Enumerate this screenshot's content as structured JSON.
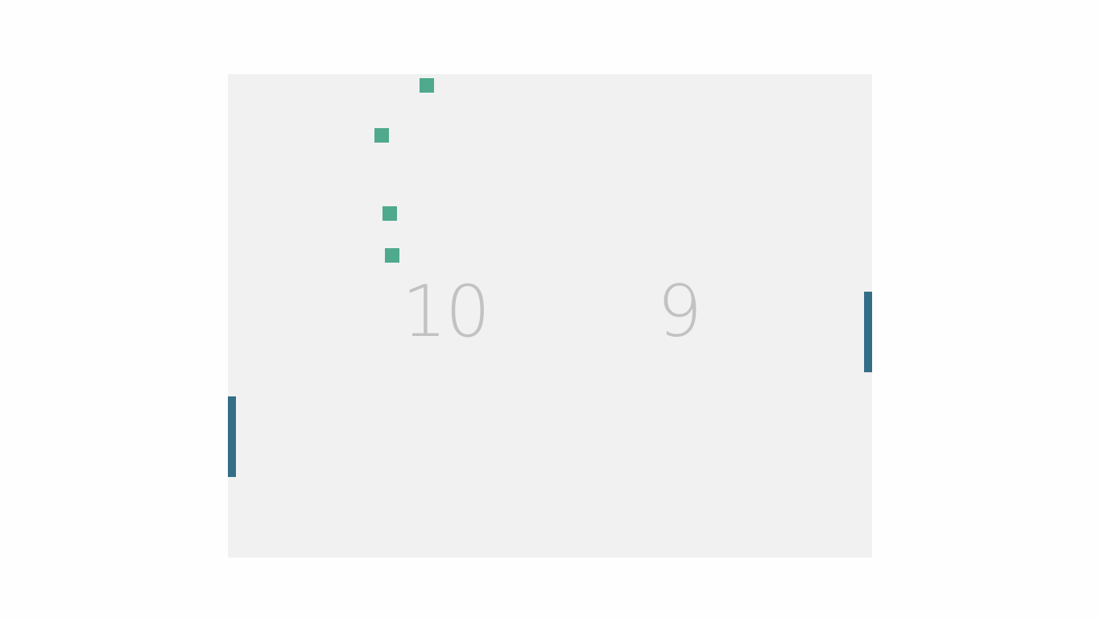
{
  "colors": {
    "page_background": "#fefefe",
    "court_background": "#f1f1f1",
    "paddle": "#346e86",
    "ball": "#4fa98d",
    "score_text": "#c2c2c2"
  },
  "scores": {
    "left": "10",
    "right": "9"
  },
  "balls": {
    "count": 4
  }
}
